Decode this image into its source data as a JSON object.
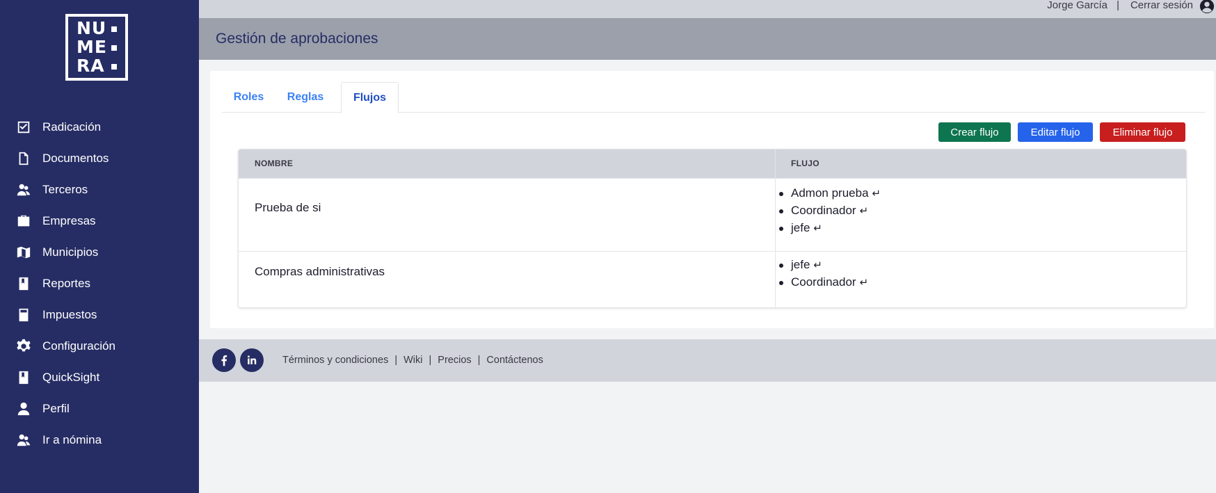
{
  "brand": {
    "logo_lines": [
      "NU",
      "ME",
      "RA"
    ]
  },
  "sidebar": {
    "items": [
      {
        "label": "Radicación",
        "icon": "check-square-icon"
      },
      {
        "label": "Documentos",
        "icon": "document-icon"
      },
      {
        "label": "Terceros",
        "icon": "users-icon"
      },
      {
        "label": "Empresas",
        "icon": "briefcase-icon"
      },
      {
        "label": "Municipios",
        "icon": "map-icon"
      },
      {
        "label": "Reportes",
        "icon": "book-icon"
      },
      {
        "label": "Impuestos",
        "icon": "calculator-icon"
      },
      {
        "label": "Configuración",
        "icon": "gear-icon"
      },
      {
        "label": "QuickSight",
        "icon": "book-icon"
      },
      {
        "label": "Perfil",
        "icon": "user-icon"
      },
      {
        "label": "Ir a nómina",
        "icon": "users-icon"
      }
    ]
  },
  "topbar": {
    "user_name": "Jorge García",
    "separator": "|",
    "logout_label": "Cerrar sesión"
  },
  "header": {
    "title": "Gestión de aprobaciones"
  },
  "tabs": [
    {
      "label": "Roles",
      "active": false
    },
    {
      "label": "Reglas",
      "active": false
    },
    {
      "label": "Flujos",
      "active": true
    }
  ],
  "actions": {
    "create_label": "Crear flujo",
    "edit_label": "Editar flujo",
    "delete_label": "Eliminar flujo"
  },
  "table": {
    "columns": [
      "NOMBRE",
      "FLUJO"
    ],
    "rows": [
      {
        "name": "Prueba de si",
        "flow": [
          "Admon prueba",
          "Coordinador",
          "jefe"
        ]
      },
      {
        "name": "Compras administrativas",
        "flow": [
          "jefe",
          "Coordinador"
        ]
      }
    ],
    "flow_arrow": "↵"
  },
  "footer": {
    "social": [
      "facebook-icon",
      "linkedin-icon"
    ],
    "links": [
      "Términos y condiciones",
      "Wiki",
      "Precios",
      "Contáctenos"
    ],
    "separator": "|"
  },
  "colors": {
    "sidebar": "#262d64",
    "create": "#0d7550",
    "edit": "#2563eb",
    "delete": "#c81e1e",
    "tab_link": "#3b82f6"
  }
}
